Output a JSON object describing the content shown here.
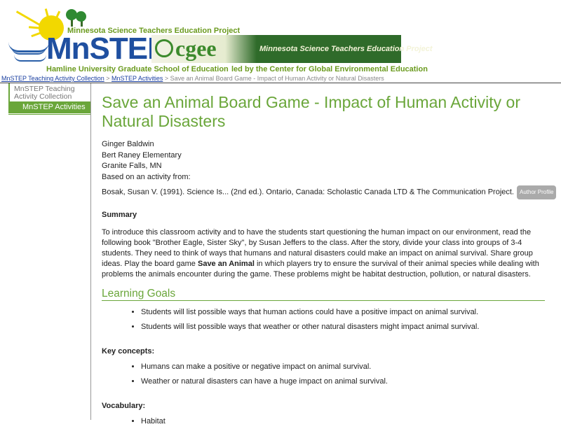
{
  "header": {
    "top_line": "Minnesota Science Teachers Education Project",
    "logo": "MnSTEP",
    "subtitle": "Hamline University Graduate School of Education",
    "cgee_logo": "cgee",
    "cgee_project": "Minnesota Science Teachers Education Project",
    "led_by": "led by the Center for Global Environmental Education"
  },
  "breadcrumb": {
    "item1": "MnSTEP Teaching Activity Collection",
    "sep1": " > ",
    "item2": "MnSTEP Activities",
    "sep2": " > ",
    "current": "Save an Animal Board Game - Impact of Human Activity or Natural Disasters"
  },
  "sidebar": {
    "collection": "MnSTEP Teaching Activity Collection",
    "active": "MnSTEP Activities"
  },
  "page": {
    "title": "Save an Animal Board Game - Impact of Human Activity or Natural Disasters",
    "author": "Ginger Baldwin",
    "school": "Bert Raney Elementary",
    "location": "Granite Falls, MN",
    "based_on": "Based on an activity from:",
    "citation": "Bosak, Susan V. (1991). Science Is... (2nd ed.). Ontario, Canada: Scholastic Canada LTD & The Communication Project.",
    "author_profile": "Author Profile",
    "summary_label": "Summary",
    "summary_part1": "To introduce this classroom activity and to have the students start questioning the human impact on our environment, read the following book \"Brother Eagle, Sister Sky\", by Susan Jeffers to the class. After the story, divide your class into groups of 3-4 students. They need to think of ways that humans and natural disasters could make an impact on animal survival. Share group ideas. Play the board game ",
    "summary_bold": "Save an Animal",
    "summary_part2": " in which players try to ensure the survival of their animal species while dealing with problems the animals encounter during the game. These problems might be habitat destruction, pollution, or natural disasters.",
    "learning_goals_heading": "Learning Goals",
    "goals": [
      "Students will list possible ways that human actions could have a positive impact on animal survival.",
      "Students will list possible ways that weather or other natural disasters might impact animal survival."
    ],
    "key_concepts_label": "Key concepts:",
    "key_concepts": [
      "Humans can make a positive or negative impact on animal survival.",
      "Weather or natural disasters can have a huge impact on animal survival."
    ],
    "vocabulary_label": "Vocabulary:",
    "vocabulary": [
      "Habitat"
    ]
  },
  "colors": {
    "accent": "#6aa63a",
    "link": "#1a3fa0",
    "logo_blue": "#1f4fa0"
  }
}
